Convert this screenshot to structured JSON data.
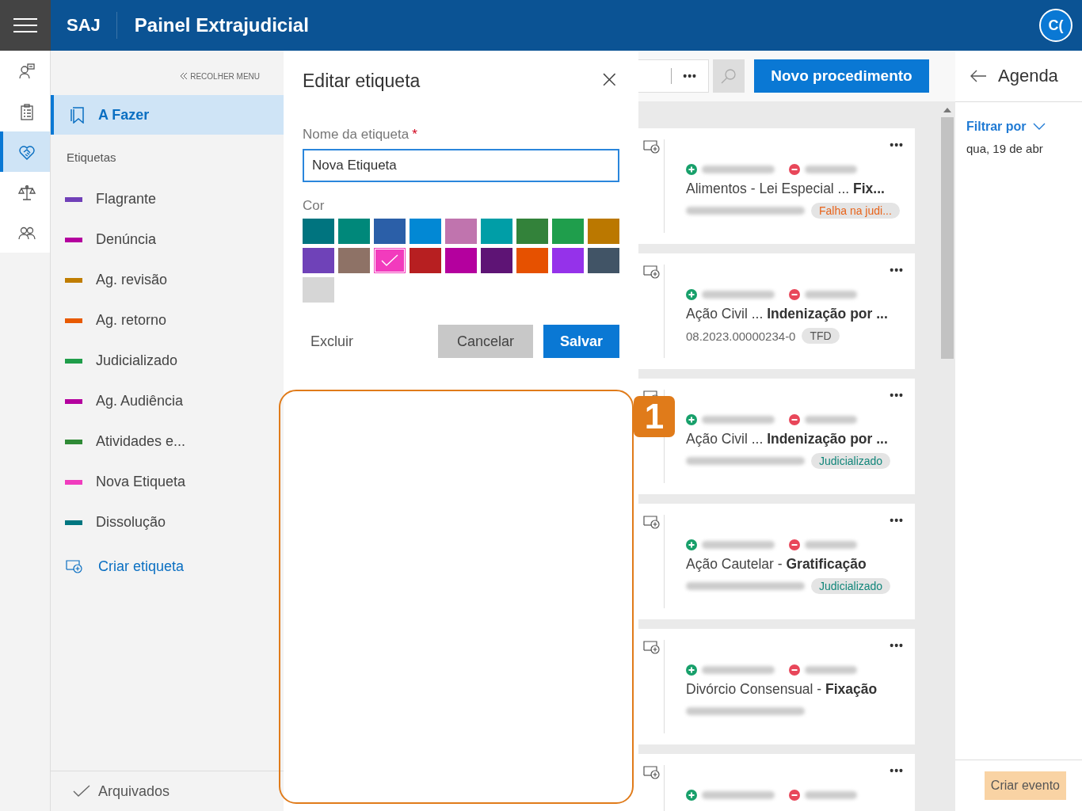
{
  "header": {
    "brand": "SAJ",
    "title": "Painel Extrajudicial",
    "avatar": "C("
  },
  "rail": [
    {
      "kind": "person-chat",
      "selected": false
    },
    {
      "kind": "clipboard",
      "selected": false
    },
    {
      "kind": "handshake",
      "selected": true
    },
    {
      "kind": "scales",
      "selected": false
    },
    {
      "kind": "people",
      "selected": false
    }
  ],
  "sidebar": {
    "collapse": "RECOLHER MENU",
    "active_item": {
      "label": "A Fazer",
      "selected": true
    },
    "section": "Etiquetas",
    "labels": [
      {
        "label": "Flagrante",
        "color": "#7040b8"
      },
      {
        "label": "Denúncia",
        "color": "#b4009e"
      },
      {
        "label": "Ag. revisão",
        "color": "#c07d00"
      },
      {
        "label": "Ag. retorno",
        "color": "#e85a00"
      },
      {
        "label": "Judicializado",
        "color": "#1f9d4a"
      },
      {
        "label": "Ag. Audiência",
        "color": "#b4009e"
      },
      {
        "label": "Atividades e...",
        "color": "#2f8a36"
      },
      {
        "label": "Nova Etiqueta",
        "color": "#f03cbe"
      },
      {
        "label": "Dissolução",
        "color": "#007680"
      }
    ],
    "create": "Criar etiqueta",
    "archived": "Arquivados"
  },
  "dialog": {
    "title": "Editar etiqueta",
    "close": "×",
    "name_label": "Nome da etiqueta",
    "required": "*",
    "name_value": "Nova Etiqueta",
    "color_label": "Cor",
    "swatches": [
      {
        "color": "#00747f",
        "selected": false
      },
      {
        "color": "#00887a",
        "selected": false
      },
      {
        "color": "#2b5fa8",
        "selected": false
      },
      {
        "color": "#0288d4",
        "selected": false
      },
      {
        "color": "#c074ae",
        "selected": false
      },
      {
        "color": "#009ea7",
        "selected": false
      },
      {
        "color": "#33823a",
        "selected": false
      },
      {
        "color": "#1f9e4c",
        "selected": false
      },
      {
        "color": "#bb7800",
        "selected": false
      },
      {
        "color": "#6f42b8",
        "selected": false
      },
      {
        "color": "#8e7266",
        "selected": false
      },
      {
        "color": "#f23bbd",
        "selected": true
      },
      {
        "color": "#b71f21",
        "selected": false
      },
      {
        "color": "#b4009e",
        "selected": false
      },
      {
        "color": "#5e1475",
        "selected": false
      },
      {
        "color": "#e65100",
        "selected": false
      },
      {
        "color": "#9532ea",
        "selected": false
      },
      {
        "color": "#415466",
        "selected": false
      },
      {
        "color": "#d6d6d6",
        "selected": false
      }
    ],
    "buttons": {
      "delete": "Excluir",
      "cancel": "Cancelar",
      "save": "Salvar"
    }
  },
  "annotation": {
    "number": "1"
  },
  "toolbar": {
    "more": "•••",
    "new_button": "Novo procedimento"
  },
  "cards": [
    {
      "more": "•••",
      "title": "Alimentos - Lei Especial ...  **Fix...**",
      "tag": {
        "text": "Falha na judi...",
        "color": "#e8641b"
      }
    },
    {
      "more": "•••",
      "title": "Ação Civil ...  **Indenização por ...**",
      "number": "08.2023.00000234-0",
      "tag": {
        "text": "TFD",
        "color": "#555555"
      }
    },
    {
      "more": "•••",
      "title": "Ação Civil ...  **Indenização por ...**",
      "tag": {
        "text": "Judicializado",
        "color": "#12867a"
      }
    },
    {
      "more": "•••",
      "title": "Ação Cautelar - **Gratificação**",
      "tag": {
        "text": "Judicializado",
        "color": "#12867a"
      }
    },
    {
      "more": "•••",
      "title": "Divórcio Consensual - **Fixação**"
    },
    {
      "more": "•••"
    }
  ],
  "agenda": {
    "title": "Agenda",
    "filter": "Filtrar por",
    "date": "qua, 19 de abr",
    "create_event": "Criar evento"
  }
}
